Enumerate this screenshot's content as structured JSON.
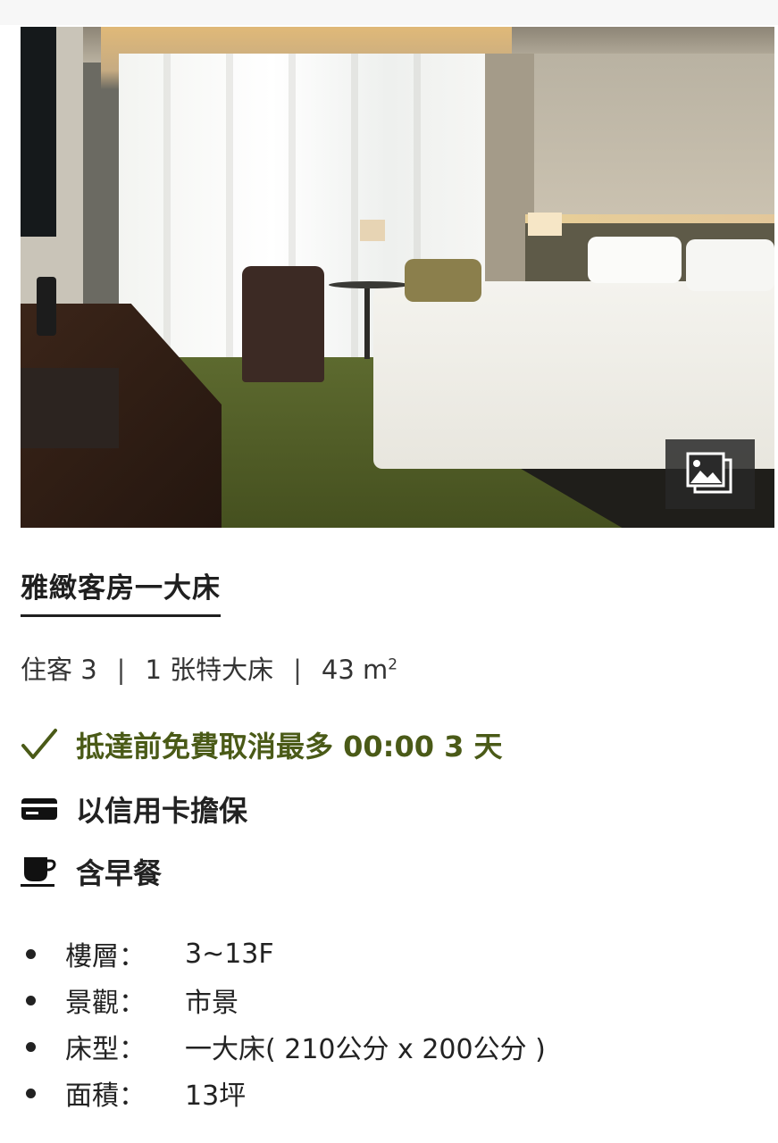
{
  "room": {
    "name": "雅緻客房一大床",
    "specs": {
      "guests": "住客 3",
      "bed": "1 张特大床",
      "area": "43 m",
      "area_unit_sup": "2"
    },
    "perks": {
      "cancellation": "抵達前免費取消最多 00:00 3 天",
      "guarantee": "以信用卡擔保",
      "breakfast": "含早餐"
    },
    "details": [
      {
        "label": "樓層：",
        "value": "3~13F"
      },
      {
        "label": "景觀：",
        "value": "市景"
      },
      {
        "label": "床型：",
        "value": "一大床( 210公分 x 200公分 )"
      },
      {
        "label": "面積：",
        "value": "13坪"
      }
    ]
  },
  "icons": {
    "gallery": "gallery-icon",
    "check": "check-icon",
    "credit_card": "credit-card-icon",
    "coffee": "coffee-cup-icon"
  },
  "colors": {
    "accent_green": "#4a5a17",
    "text": "#222222"
  }
}
